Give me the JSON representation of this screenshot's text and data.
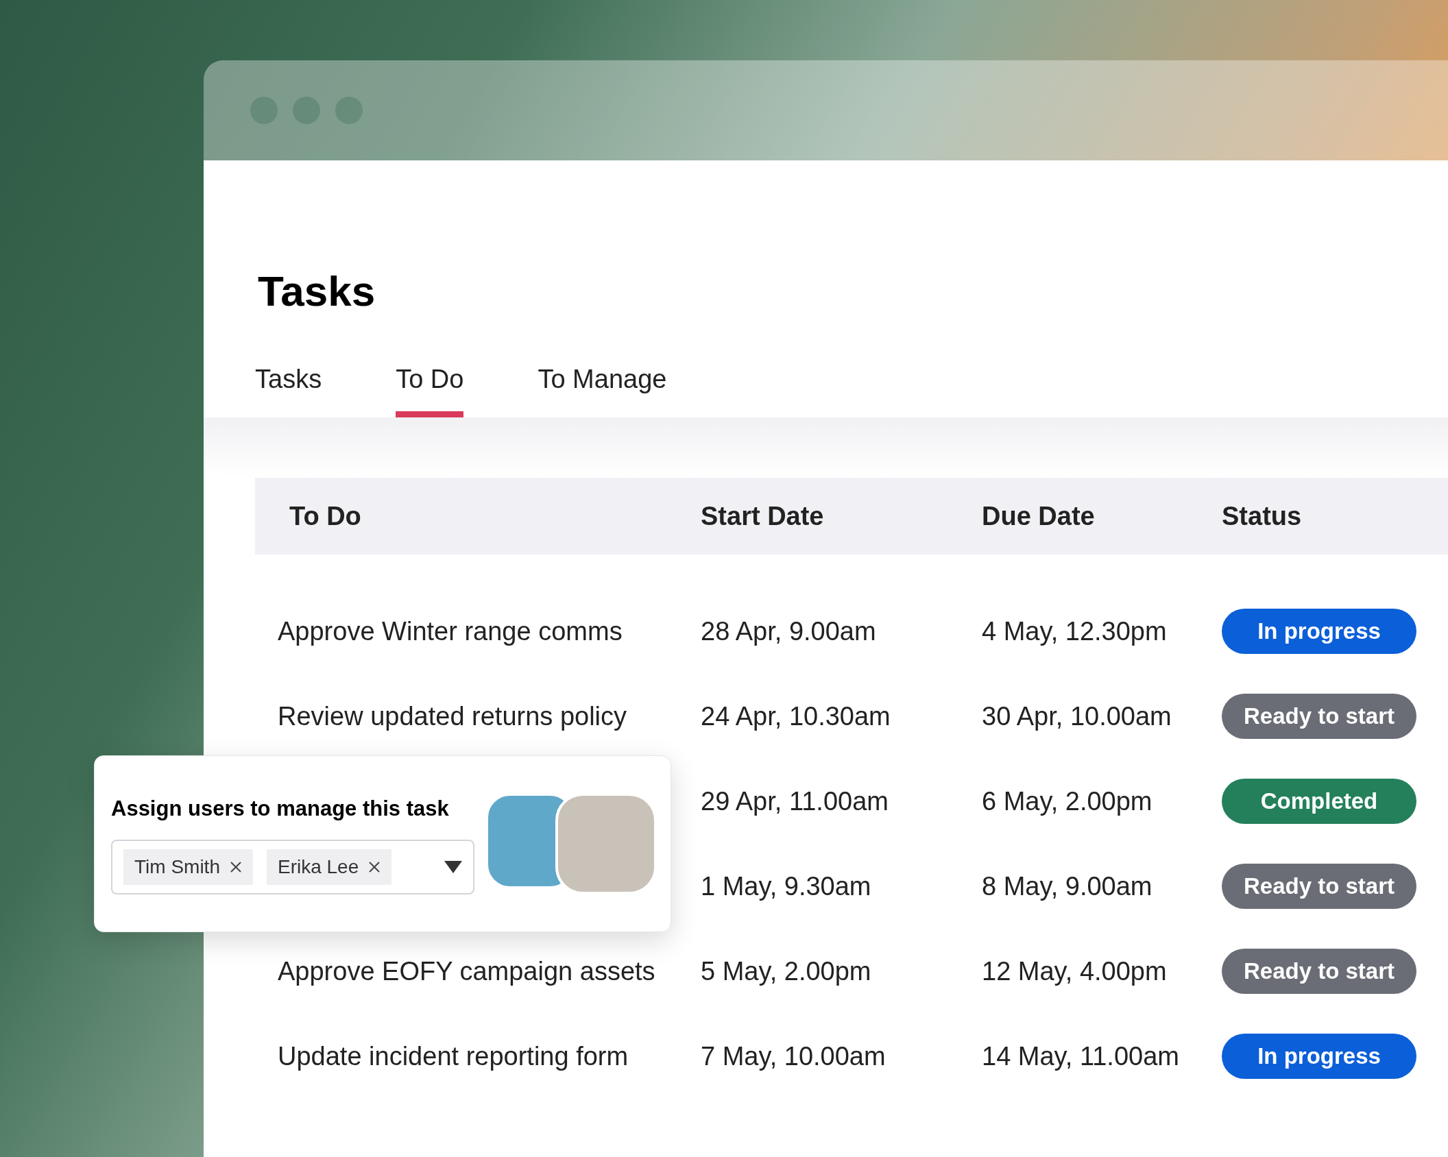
{
  "page": {
    "title": "Tasks"
  },
  "tabs": [
    {
      "label": "Tasks",
      "selected": false
    },
    {
      "label": "To Do",
      "selected": true
    },
    {
      "label": "To Manage",
      "selected": false
    }
  ],
  "table": {
    "columns": [
      "To Do",
      "Start Date",
      "Due Date",
      "Status"
    ],
    "rows": [
      {
        "task": "Approve Winter range comms",
        "start": "28 Apr, 9.00am",
        "due": "4 May, 12.30pm",
        "status": {
          "label": "In progress",
          "color": "#0b5fd8"
        }
      },
      {
        "task": "Review updated returns policy",
        "start": "24 Apr, 10.30am",
        "due": "30 Apr, 10.00am",
        "status": {
          "label": "Ready to start",
          "color": "#6a6d75"
        }
      },
      {
        "start": "29 Apr, 11.00am",
        "due": "6 May, 2.00pm",
        "status": {
          "label": "Completed",
          "color": "#23805b"
        }
      },
      {
        "start": "1 May, 9.30am",
        "due": "8 May, 9.00am",
        "status": {
          "label": "Ready to start",
          "color": "#6a6d75"
        }
      },
      {
        "task": "Approve EOFY campaign assets",
        "start": "5 May, 2.00pm",
        "due": "12 May, 4.00pm",
        "status": {
          "label": "Ready to start",
          "color": "#6a6d75"
        }
      },
      {
        "task": "Update incident reporting form",
        "start": "7 May, 10.00am",
        "due": "14 May, 11.00am",
        "status": {
          "label": "In progress",
          "color": "#0b5fd8"
        }
      }
    ]
  },
  "assign_popup": {
    "title": "Assign users to manage this task",
    "users": [
      {
        "name": "Tim Smith"
      },
      {
        "name": "Erika Lee"
      }
    ]
  }
}
